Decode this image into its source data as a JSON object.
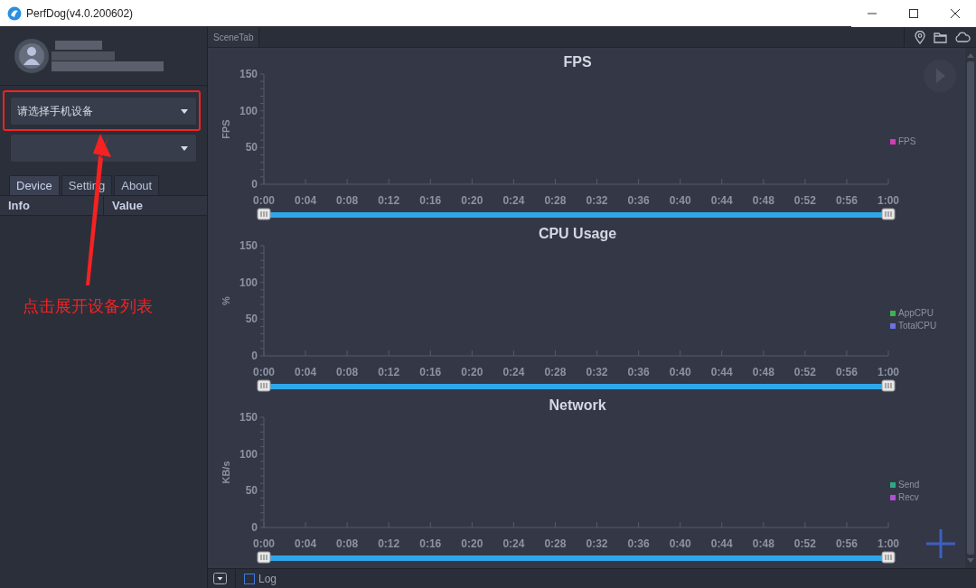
{
  "window": {
    "title": "PerfDog(v4.0.200602)"
  },
  "sidebar": {
    "device_select": {
      "placeholder": "请选择手机设备"
    },
    "tabs": [
      {
        "label": "Device",
        "selected": true
      },
      {
        "label": "Setting",
        "selected": false
      },
      {
        "label": "About",
        "selected": false
      }
    ],
    "columns": [
      "Info",
      "Value"
    ]
  },
  "annotation": {
    "text": "点击展开设备列表"
  },
  "scene_tab": {
    "label": "SceneTab"
  },
  "charts": [
    {
      "chart_data": {
        "type": "line",
        "title": "FPS",
        "ylabel": "FPS",
        "ylim": [
          0,
          150
        ],
        "yticks": [
          0,
          50,
          100,
          150
        ],
        "categories": [
          "0:00",
          "0:04",
          "0:08",
          "0:12",
          "0:16",
          "0:20",
          "0:24",
          "0:28",
          "0:32",
          "0:36",
          "0:40",
          "0:44",
          "0:48",
          "0:52",
          "0:56",
          "1:00"
        ],
        "series": [
          {
            "name": "FPS",
            "color": "#d23cb4",
            "values": [
              null,
              null,
              null,
              null,
              null,
              null,
              null,
              null,
              null,
              null,
              null,
              null,
              null,
              null,
              null,
              null
            ]
          }
        ]
      }
    },
    {
      "chart_data": {
        "type": "line",
        "title": "CPU Usage",
        "ylabel": "%",
        "ylim": [
          0,
          150
        ],
        "yticks": [
          0,
          50,
          100,
          150
        ],
        "categories": [
          "0:00",
          "0:04",
          "0:08",
          "0:12",
          "0:16",
          "0:20",
          "0:24",
          "0:28",
          "0:32",
          "0:36",
          "0:40",
          "0:44",
          "0:48",
          "0:52",
          "0:56",
          "1:00"
        ],
        "series": [
          {
            "name": "AppCPU",
            "color": "#3fb24e",
            "values": [
              null,
              null,
              null,
              null,
              null,
              null,
              null,
              null,
              null,
              null,
              null,
              null,
              null,
              null,
              null,
              null
            ]
          },
          {
            "name": "TotalCPU",
            "color": "#6c72e0",
            "values": [
              null,
              null,
              null,
              null,
              null,
              null,
              null,
              null,
              null,
              null,
              null,
              null,
              null,
              null,
              null,
              null
            ]
          }
        ]
      }
    },
    {
      "chart_data": {
        "type": "line",
        "title": "Network",
        "ylabel": "KB/s",
        "ylim": [
          0,
          150
        ],
        "yticks": [
          0,
          50,
          100,
          150
        ],
        "categories": [
          "0:00",
          "0:04",
          "0:08",
          "0:12",
          "0:16",
          "0:20",
          "0:24",
          "0:28",
          "0:32",
          "0:36",
          "0:40",
          "0:44",
          "0:48",
          "0:52",
          "0:56",
          "1:00"
        ],
        "series": [
          {
            "name": "Send",
            "color": "#2fa884",
            "values": [
              null,
              null,
              null,
              null,
              null,
              null,
              null,
              null,
              null,
              null,
              null,
              null,
              null,
              null,
              null,
              null
            ]
          },
          {
            "name": "Recv",
            "color": "#b24fd2",
            "values": [
              null,
              null,
              null,
              null,
              null,
              null,
              null,
              null,
              null,
              null,
              null,
              null,
              null,
              null,
              null,
              null
            ]
          }
        ]
      }
    }
  ],
  "bottom_bar": {
    "log": {
      "label": "Log",
      "checked": false
    }
  }
}
